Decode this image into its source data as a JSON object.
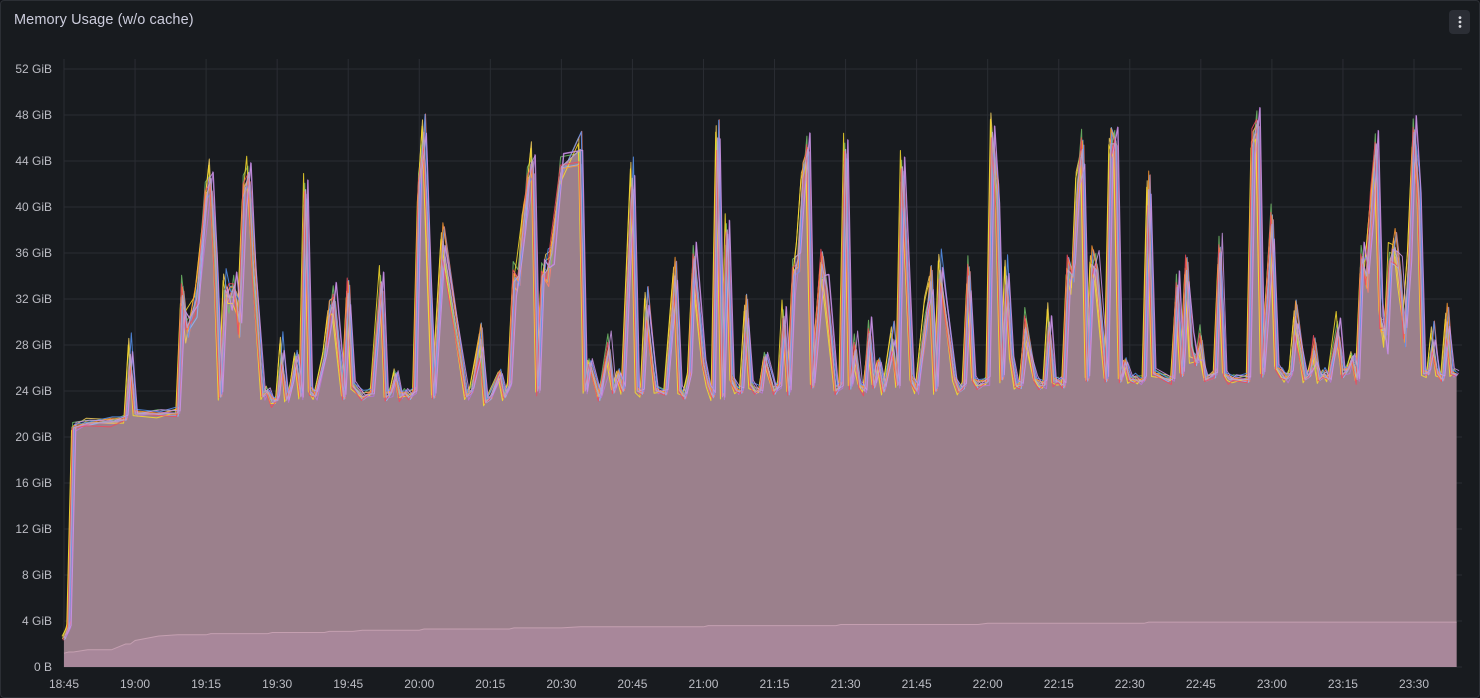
{
  "panel": {
    "title": "Memory Usage (w/o cache)",
    "menu_icon": "vertical-ellipsis-icon"
  },
  "colors": {
    "background": "#181b1f",
    "grid": "#2a2d33",
    "area_fill": "#9b808c",
    "lower_band": "#a8879a",
    "lower_line": "#c49fb0",
    "series_palette": [
      "#f2ce5c",
      "#ff7f6e",
      "#8ab8ff",
      "#73bf69",
      "#b877d9",
      "#fade2a",
      "#5794f2",
      "#ff9830",
      "#f2495c",
      "#ca95e5"
    ]
  },
  "chart_data": {
    "type": "area",
    "title": "Memory Usage (w/o cache)",
    "xlabel": "",
    "ylabel": "",
    "ylim": [
      0,
      52
    ],
    "y_unit": "GiB",
    "y_ticks": [
      "0 B",
      "4 GiB",
      "8 GiB",
      "12 GiB",
      "16 GiB",
      "20 GiB",
      "24 GiB",
      "28 GiB",
      "32 GiB",
      "36 GiB",
      "40 GiB",
      "44 GiB",
      "48 GiB",
      "52 GiB"
    ],
    "x_ticks": [
      "18:45",
      "19:00",
      "19:15",
      "19:30",
      "19:45",
      "20:00",
      "20:15",
      "20:30",
      "20:45",
      "21:00",
      "21:15",
      "21:30",
      "21:45",
      "22:00",
      "22:15",
      "22:30",
      "22:45",
      "23:00",
      "23:15",
      "23:30"
    ],
    "x": [
      "18:45",
      "18:46",
      "18:47",
      "18:50",
      "18:55",
      "18:58",
      "18:59",
      "19:00",
      "19:05",
      "19:09",
      "19:10",
      "19:11",
      "19:13",
      "19:15",
      "19:16",
      "19:17",
      "19:18",
      "19:19",
      "19:20",
      "19:21",
      "19:22",
      "19:23",
      "19:24",
      "19:25",
      "19:27",
      "19:28",
      "19:29",
      "19:30",
      "19:31",
      "19:32",
      "19:33",
      "19:34",
      "19:35",
      "19:36",
      "19:37",
      "19:38",
      "19:40",
      "19:41",
      "19:42",
      "19:44",
      "19:45",
      "19:46",
      "19:48",
      "19:50",
      "19:52",
      "19:53",
      "19:54",
      "19:55",
      "19:56",
      "19:57",
      "19:58",
      "19:59",
      "20:00",
      "20:01",
      "20:02",
      "20:03",
      "20:05",
      "20:10",
      "20:11",
      "20:13",
      "20:14",
      "20:15",
      "20:17",
      "20:18",
      "20:19",
      "20:20",
      "20:21",
      "20:22",
      "20:23",
      "20:24",
      "20:25",
      "20:26",
      "20:27",
      "20:28",
      "20:30",
      "20:34",
      "20:35",
      "20:36",
      "20:38",
      "20:40",
      "20:41",
      "20:42",
      "20:43",
      "20:45",
      "20:46",
      "20:47",
      "20:48",
      "20:50",
      "20:52",
      "20:54",
      "20:55",
      "20:56",
      "20:57",
      "20:58",
      "21:00",
      "21:01",
      "21:02",
      "21:03",
      "21:04",
      "21:05",
      "21:06",
      "21:07",
      "21:08",
      "21:09",
      "21:10",
      "21:11",
      "21:12",
      "21:13",
      "21:15",
      "21:16",
      "21:17",
      "21:18",
      "21:19",
      "21:20",
      "21:21",
      "21:22",
      "21:23",
      "21:25",
      "21:26",
      "21:28",
      "21:29",
      "21:30",
      "21:31",
      "21:32",
      "21:33",
      "21:34",
      "21:35",
      "21:36",
      "21:37",
      "21:38",
      "21:40",
      "21:41",
      "21:42",
      "21:44",
      "21:45",
      "21:47",
      "21:48",
      "21:49",
      "21:50",
      "21:53",
      "21:54",
      "21:55",
      "21:56",
      "21:57",
      "21:58",
      "22:00",
      "22:01",
      "22:02",
      "22:03",
      "22:04",
      "22:05",
      "22:06",
      "22:07",
      "22:08",
      "22:10",
      "22:11",
      "22:12",
      "22:13",
      "22:14",
      "22:15",
      "22:16",
      "22:17",
      "22:18",
      "22:19",
      "22:20",
      "22:21",
      "22:22",
      "22:23",
      "22:25",
      "22:26",
      "22:27",
      "22:28",
      "22:29",
      "22:30",
      "22:31",
      "22:32",
      "22:33",
      "22:34",
      "22:35",
      "22:38",
      "22:39",
      "22:40",
      "22:41",
      "22:42",
      "22:43",
      "22:44",
      "22:45",
      "22:46",
      "22:48",
      "22:49",
      "22:50",
      "22:51",
      "22:52",
      "22:55",
      "22:56",
      "22:57",
      "22:58",
      "23:00",
      "23:01",
      "23:02",
      "23:03",
      "23:04",
      "23:05",
      "23:07",
      "23:08",
      "23:09",
      "23:10",
      "23:11",
      "23:12",
      "23:14",
      "23:15",
      "23:16",
      "23:17",
      "23:18",
      "23:19",
      "23:20",
      "23:21",
      "23:22",
      "23:23",
      "23:24",
      "23:25",
      "23:26",
      "23:27",
      "23:28",
      "23:29",
      "23:30",
      "23:31",
      "23:32",
      "23:33",
      "23:34",
      "23:35",
      "23:36",
      "23:37",
      "23:38",
      "23:39"
    ],
    "series": [
      {
        "values": [
          2.5,
          3.5,
          20.8,
          21.2,
          21.3,
          21.5,
          27.2,
          22.0,
          22.0,
          22.1,
          32.3,
          29.5,
          32.0,
          40.7,
          42.5,
          35.0,
          23.5,
          32.8,
          32.0,
          33.2,
          30.0,
          41.0,
          43.0,
          35.0,
          23.5,
          24.0,
          23.0,
          23.2,
          27.3,
          23.2,
          24.5,
          27.0,
          23.5,
          41.5,
          24.0,
          23.5,
          27.0,
          30.5,
          32.0,
          23.5,
          32.5,
          24.5,
          23.5,
          23.8,
          33.5,
          23.5,
          23.8,
          25.5,
          23.5,
          23.8,
          23.5,
          24.0,
          42.0,
          46.5,
          35.5,
          23.5,
          37.0,
          23.5,
          24.0,
          28.5,
          23.0,
          23.5,
          25.5,
          23.5,
          24.5,
          33.5,
          34.0,
          38.5,
          42.0,
          44.0,
          24.0,
          34.0,
          34.5,
          36.0,
          43.5,
          45.0,
          24.0,
          26.5,
          23.5,
          27.5,
          24.0,
          25.5,
          24.0,
          42.5,
          24.0,
          23.8,
          31.5,
          24.0,
          23.8,
          34.0,
          24.0,
          23.5,
          25.5,
          35.5,
          26.5,
          24.5,
          23.5,
          46.0,
          23.5,
          38.0,
          25.0,
          24.0,
          24.0,
          31.0,
          24.5,
          24.0,
          24.0,
          27.0,
          24.0,
          24.5,
          30.5,
          24.0,
          34.0,
          35.5,
          42.5,
          45.0,
          24.5,
          35.0,
          33.0,
          24.0,
          24.5,
          45.0,
          24.5,
          27.5,
          24.5,
          24.0,
          29.0,
          24.5,
          26.5,
          24.0,
          28.5,
          24.5,
          43.5,
          25.0,
          24.0,
          30.5,
          33.5,
          24.0,
          34.5,
          25.0,
          24.0,
          24.5,
          34.0,
          25.0,
          24.5,
          24.8,
          46.5,
          41.0,
          25.0,
          34.0,
          27.0,
          24.5,
          24.5,
          29.5,
          25.0,
          24.5,
          24.5,
          30.0,
          24.8,
          24.8,
          24.5,
          34.5,
          34.0,
          42.0,
          45.0,
          25.0,
          35.0,
          34.5,
          25.0,
          45.5,
          45.5,
          25.0,
          26.5,
          25.0,
          25.0,
          24.8,
          25.0,
          41.5,
          25.5,
          25.0,
          25.0,
          33.0,
          25.5,
          34.5,
          28.0,
          26.5,
          28.0,
          25.0,
          25.5,
          36.0,
          25.5,
          25.0,
          25.0,
          25.0,
          45.5,
          47.5,
          25.5,
          38.5,
          26.0,
          25.5,
          25.0,
          25.5,
          30.5,
          25.0,
          25.5,
          27.5,
          25.0,
          25.5,
          25.0,
          29.5,
          25.5,
          25.8,
          27.0,
          25.0,
          35.5,
          34.0,
          40.0,
          45.5,
          30.5,
          28.5,
          35.5,
          36.5,
          34.0,
          29.0,
          36.0,
          46.5,
          41.0,
          25.5,
          25.5,
          28.5,
          25.5,
          25.0,
          30.0,
          25.5,
          25.5
        ]
      },
      {
        "values": [
          1.2,
          1.3,
          1.3,
          1.5,
          1.5,
          2.0,
          2.0,
          2.3,
          2.7,
          2.8,
          2.8,
          2.8,
          2.8,
          2.8,
          2.9,
          2.9,
          2.9,
          2.9,
          2.9,
          2.9,
          2.9,
          2.9,
          2.9,
          2.9,
          2.9,
          2.9,
          3.0,
          3.0,
          3.0,
          3.0,
          3.0,
          3.0,
          3.0,
          3.0,
          3.0,
          3.0,
          3.0,
          3.1,
          3.1,
          3.1,
          3.1,
          3.1,
          3.2,
          3.2,
          3.2,
          3.2,
          3.2,
          3.2,
          3.2,
          3.2,
          3.2,
          3.2,
          3.2,
          3.3,
          3.3,
          3.3,
          3.3,
          3.3,
          3.3,
          3.3,
          3.3,
          3.3,
          3.3,
          3.3,
          3.3,
          3.4,
          3.4,
          3.4,
          3.4,
          3.4,
          3.4,
          3.4,
          3.4,
          3.4,
          3.4,
          3.5,
          3.5,
          3.5,
          3.5,
          3.5,
          3.5,
          3.5,
          3.5,
          3.5,
          3.5,
          3.5,
          3.5,
          3.5,
          3.5,
          3.5,
          3.5,
          3.5,
          3.5,
          3.5,
          3.5,
          3.6,
          3.6,
          3.6,
          3.6,
          3.6,
          3.6,
          3.6,
          3.6,
          3.6,
          3.6,
          3.6,
          3.6,
          3.6,
          3.6,
          3.6,
          3.6,
          3.6,
          3.6,
          3.6,
          3.6,
          3.6,
          3.6,
          3.6,
          3.6,
          3.6,
          3.7,
          3.7,
          3.7,
          3.7,
          3.7,
          3.7,
          3.7,
          3.7,
          3.7,
          3.7,
          3.7,
          3.7,
          3.7,
          3.7,
          3.7,
          3.7,
          3.7,
          3.7,
          3.7,
          3.7,
          3.7,
          3.7,
          3.7,
          3.7,
          3.7,
          3.8,
          3.8,
          3.8,
          3.8,
          3.8,
          3.8,
          3.8,
          3.8,
          3.8,
          3.8,
          3.8,
          3.8,
          3.8,
          3.8,
          3.8,
          3.8,
          3.8,
          3.8,
          3.8,
          3.8,
          3.8,
          3.8,
          3.8,
          3.8,
          3.8,
          3.8,
          3.8,
          3.8,
          3.8,
          3.8,
          3.8,
          3.8,
          3.9,
          3.9,
          3.9,
          3.9,
          3.9,
          3.9,
          3.9,
          3.9,
          3.9,
          3.9,
          3.9,
          3.9,
          3.9,
          3.9,
          3.9,
          3.9,
          3.9,
          3.9,
          3.9,
          3.9,
          3.9,
          3.9,
          3.9,
          3.9,
          3.9,
          3.9,
          3.9,
          3.9,
          3.9,
          3.9,
          3.9,
          3.9,
          3.9,
          3.9,
          3.9,
          3.9,
          3.9,
          3.9,
          3.9,
          3.9,
          3.9,
          3.9,
          3.9,
          3.9,
          3.9,
          3.9,
          3.9,
          3.9,
          3.9,
          3.9,
          3.9,
          3.9,
          3.9,
          3.9,
          3.9,
          3.9,
          3.9,
          3.9
        ]
      }
    ],
    "grid": true,
    "legend": "none"
  }
}
